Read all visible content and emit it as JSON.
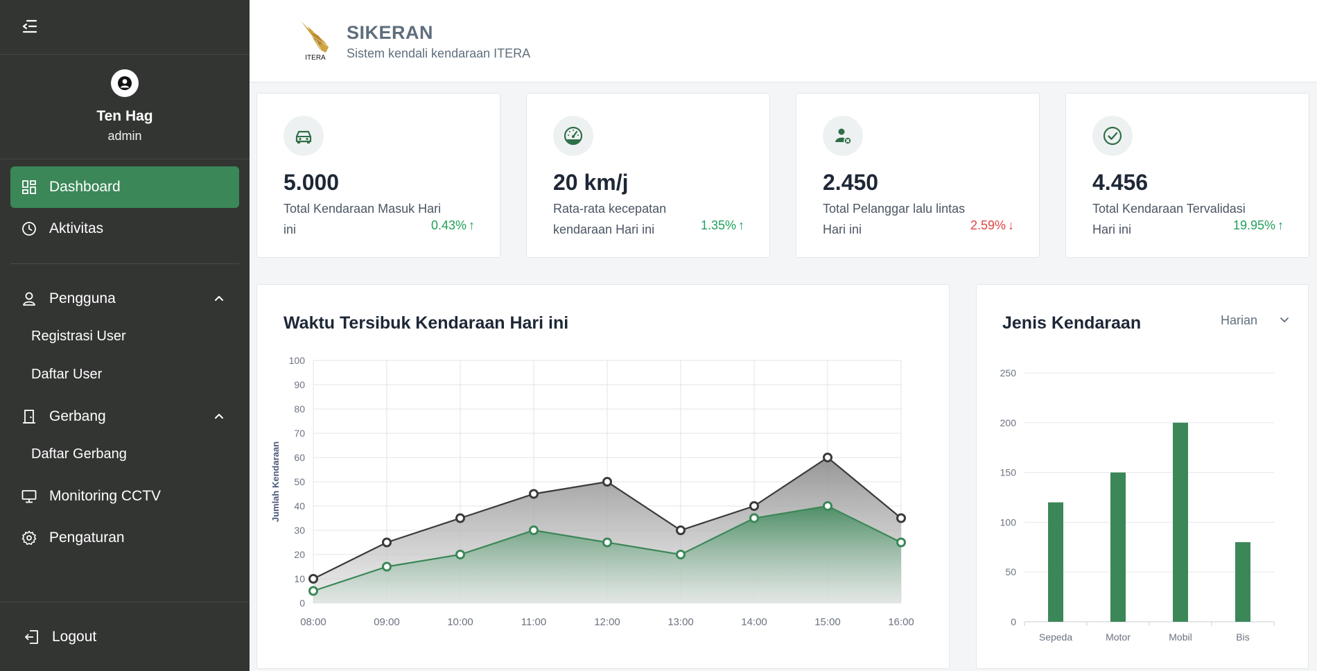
{
  "sidebar": {
    "user": {
      "name": "Ten Hag",
      "role": "admin"
    },
    "menu": {
      "dashboard": "Dashboard",
      "aktivitas": "Aktivitas",
      "pengguna": "Pengguna",
      "registrasi_user": "Registrasi User",
      "daftar_user": "Daftar User",
      "gerbang": "Gerbang",
      "daftar_gerbang": "Daftar Gerbang",
      "monitoring_cctv": "Monitoring CCTV",
      "pengaturan": "Pengaturan",
      "logout": "Logout"
    }
  },
  "header": {
    "logo_text": "ITERA",
    "title": "SIKERAN",
    "subtitle": "Sistem kendali kendaraan ITERA"
  },
  "stats": [
    {
      "icon": "car-icon",
      "value": "5.000",
      "label": "Total Kendaraan Masuk Hari ini",
      "change": "0.43%",
      "direction": "up"
    },
    {
      "icon": "speedometer-icon",
      "value": "20 km/j",
      "label": "Rata-rata kecepatan kendaraan Hari ini",
      "change": "1.35%",
      "direction": "up"
    },
    {
      "icon": "user-violation-icon",
      "value": "2.450",
      "label": "Total Pelanggar lalu lintas Hari ini",
      "change": "2.59%",
      "direction": "down"
    },
    {
      "icon": "check-circle-icon",
      "value": "4.456",
      "label": "Total Kendaraan Tervalidasi Hari ini",
      "change": "19.95%",
      "direction": "up"
    }
  ],
  "colors": {
    "accent": "#3b8758",
    "sidebar": "#333533",
    "up": "#20a05a",
    "down": "#e04444",
    "series_dark": "#3a3a3a",
    "series_green": "#3b8758"
  },
  "chart_data": [
    {
      "type": "area",
      "title": "Waktu Tersibuk Kendaraan Hari ini",
      "xlabel": "",
      "ylabel": "Jumlah Kendaraan",
      "x": [
        "08:00",
        "09:00",
        "10:00",
        "11:00",
        "12:00",
        "13:00",
        "14:00",
        "15:00",
        "16:00"
      ],
      "ylim": [
        0,
        100
      ],
      "yticks": [
        0,
        10,
        20,
        30,
        40,
        50,
        60,
        70,
        80,
        90,
        100
      ],
      "grid": true,
      "series": [
        {
          "values": [
            10,
            25,
            35,
            45,
            50,
            30,
            40,
            60,
            35
          ],
          "color": "#3a3a3a"
        },
        {
          "values": [
            5,
            15,
            20,
            30,
            25,
            20,
            35,
            40,
            25
          ],
          "color": "#3b8758"
        }
      ]
    },
    {
      "type": "bar",
      "title": "Jenis Kendaraan",
      "filter": "Harian",
      "categories": [
        "Sepeda",
        "Motor",
        "Mobil",
        "Bis"
      ],
      "values": [
        120,
        150,
        200,
        80
      ],
      "ylim": [
        0,
        250
      ],
      "yticks": [
        0,
        50,
        100,
        150,
        200,
        250
      ],
      "grid": true,
      "color": "#3b8758"
    }
  ]
}
